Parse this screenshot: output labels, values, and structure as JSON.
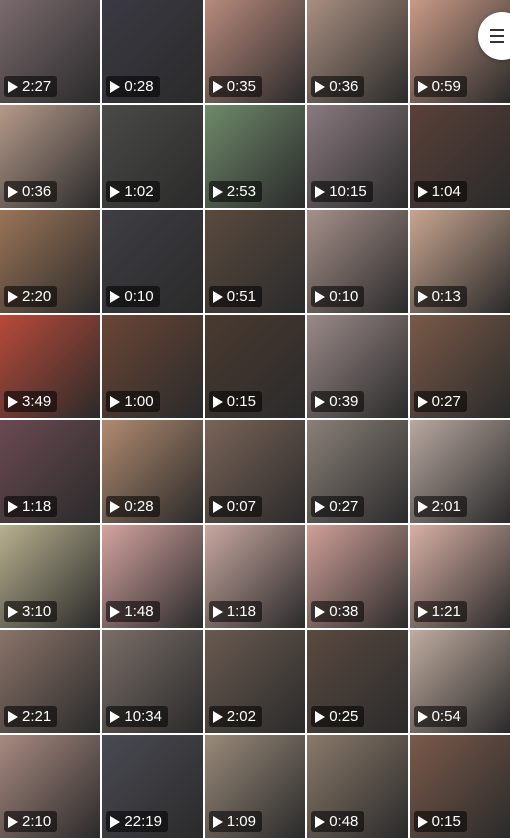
{
  "videos": [
    {
      "duration": "2:27",
      "color": "#7a6a6e"
    },
    {
      "duration": "0:28",
      "color": "#3b3a44"
    },
    {
      "duration": "0:35",
      "color": "#b88a7c"
    },
    {
      "duration": "0:36",
      "color": "#a98f80"
    },
    {
      "duration": "0:59",
      "color": "#c99a86"
    },
    {
      "duration": "0:36",
      "color": "#b59a8a"
    },
    {
      "duration": "1:02",
      "color": "#4a4a48"
    },
    {
      "duration": "2:53",
      "color": "#6f8a6a"
    },
    {
      "duration": "10:15",
      "color": "#8a7a80"
    },
    {
      "duration": "1:04",
      "color": "#5a4038"
    },
    {
      "duration": "2:20",
      "color": "#9a7458"
    },
    {
      "duration": "0:10",
      "color": "#3e3e44"
    },
    {
      "duration": "0:51",
      "color": "#5a4a3e"
    },
    {
      "duration": "0:10",
      "color": "#a6908a"
    },
    {
      "duration": "0:13",
      "color": "#c8a690"
    },
    {
      "duration": "3:49",
      "color": "#b84a3a"
    },
    {
      "duration": "1:00",
      "color": "#6a4636"
    },
    {
      "duration": "0:15",
      "color": "#4a3a30"
    },
    {
      "duration": "0:39",
      "color": "#9a8a88"
    },
    {
      "duration": "0:27",
      "color": "#7a5a48"
    },
    {
      "duration": "1:18",
      "color": "#6a4a52"
    },
    {
      "duration": "0:28",
      "color": "#b08a70"
    },
    {
      "duration": "0:07",
      "color": "#7a6458"
    },
    {
      "duration": "0:27",
      "color": "#8a8078"
    },
    {
      "duration": "2:01",
      "color": "#b8a8a0"
    },
    {
      "duration": "3:10",
      "color": "#b8b090"
    },
    {
      "duration": "1:48",
      "color": "#d4a4a0"
    },
    {
      "duration": "1:18",
      "color": "#c8a8a0"
    },
    {
      "duration": "0:38",
      "color": "#d0a098"
    },
    {
      "duration": "1:21",
      "color": "#d8b0a4"
    },
    {
      "duration": "2:21",
      "color": "#8a7468"
    },
    {
      "duration": "10:34",
      "color": "#7a6e68"
    },
    {
      "duration": "2:02",
      "color": "#6a5a50"
    },
    {
      "duration": "0:25",
      "color": "#5a4a40"
    },
    {
      "duration": "0:54",
      "color": "#c0aca0"
    },
    {
      "duration": "2:10",
      "color": "#a88a80"
    },
    {
      "duration": "22:19",
      "color": "#4a4a54"
    },
    {
      "duration": "1:09",
      "color": "#9a8a7a"
    },
    {
      "duration": "0:48",
      "color": "#8a7a6a"
    },
    {
      "duration": "0:15",
      "color": "#7a5a4a"
    }
  ]
}
